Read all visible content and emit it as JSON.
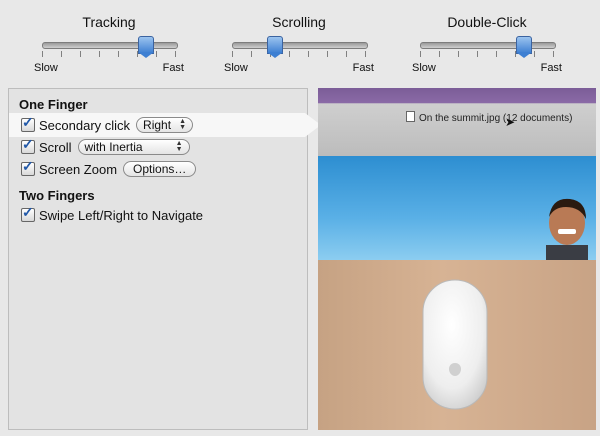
{
  "sliders": [
    {
      "title": "Tracking",
      "min_label": "Slow",
      "max_label": "Fast",
      "value_fraction": 0.74
    },
    {
      "title": "Scrolling",
      "min_label": "Slow",
      "max_label": "Fast",
      "value_fraction": 0.3
    },
    {
      "title": "Double-Click",
      "min_label": "Slow",
      "max_label": "Fast",
      "value_fraction": 0.79
    }
  ],
  "one_finger": {
    "heading": "One Finger",
    "secondary_click": {
      "label": "Secondary click",
      "checked": true,
      "value": "Right"
    },
    "scroll": {
      "label": "Scroll",
      "checked": true,
      "value": "with Inertia"
    },
    "screen_zoom": {
      "label": "Screen Zoom",
      "checked": true,
      "options_label": "Options…"
    }
  },
  "two_fingers": {
    "heading": "Two Fingers",
    "swipe": {
      "label": "Swipe Left/Right to Navigate",
      "checked": true
    }
  },
  "preview": {
    "document_title": "On the summit.jpg (12 documents)"
  },
  "icons": {
    "check": "checkmark-icon",
    "popup": "popup-arrows-icon",
    "document": "document-icon",
    "cursor": "cursor-icon"
  }
}
